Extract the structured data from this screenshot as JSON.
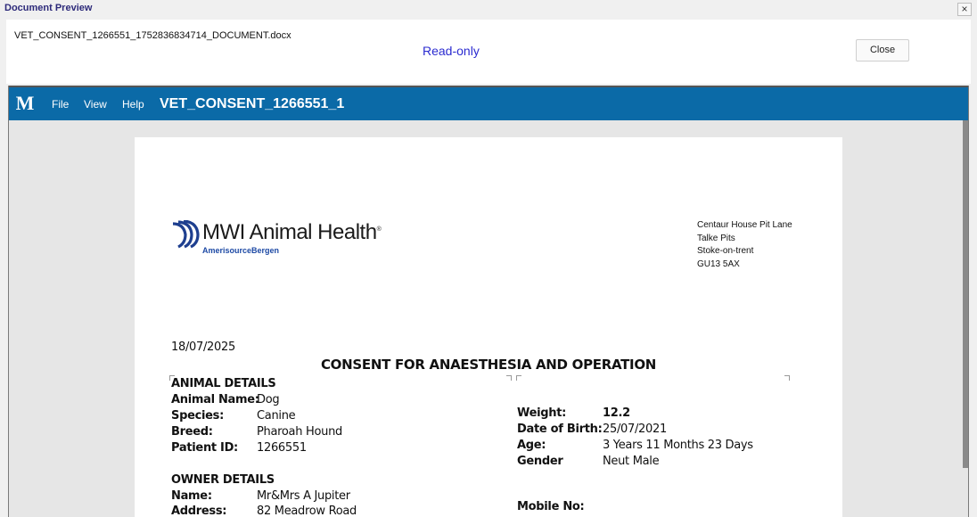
{
  "dialog": {
    "title": "Document Preview",
    "close_icon": "×",
    "filename": "VET_CONSENT_1266551_1752836834714_DOCUMENT.docx",
    "mode_label": "Read-only",
    "close_label": "Close"
  },
  "viewer": {
    "logo_letter": "M",
    "menu": [
      "File",
      "View",
      "Help"
    ],
    "doc_title": "VET_CONSENT_1266551_1"
  },
  "document": {
    "brand": {
      "name": "MWI Animal Health",
      "trademark": "®",
      "subtitle": "AmerisourceBergen"
    },
    "address": [
      "Centaur House  Pit Lane",
      "Talke Pits",
      "Stoke-on-trent",
      "GU13 5AX"
    ],
    "date": "18/07/2025",
    "heading": "CONSENT FOR ANAESTHESIA AND OPERATION",
    "animal": {
      "section_title": "ANIMAL DETAILS",
      "name_label": "Animal Name:",
      "name": "Dog",
      "species_label": "Species:",
      "species": "Canine",
      "breed_label": "Breed:",
      "breed": "Pharoah Hound",
      "patient_id_label": "Patient ID:",
      "patient_id": "1266551"
    },
    "vitals": {
      "weight_label": "Weight:",
      "weight": "12.2",
      "dob_label": "Date of Birth:",
      "dob": "25/07/2021",
      "age_label": "Age:",
      "age": "3 Years 11 Months 23 Days",
      "gender_label": "Gender",
      "gender": "Neut Male"
    },
    "owner": {
      "section_title": "OWNER DETAILS",
      "name_label": "Name:",
      "name": "Mr&Mrs A Jupiter",
      "address_label": "Address:",
      "address": "82 Meadrow Road",
      "mobile_label": "Mobile No:"
    }
  }
}
